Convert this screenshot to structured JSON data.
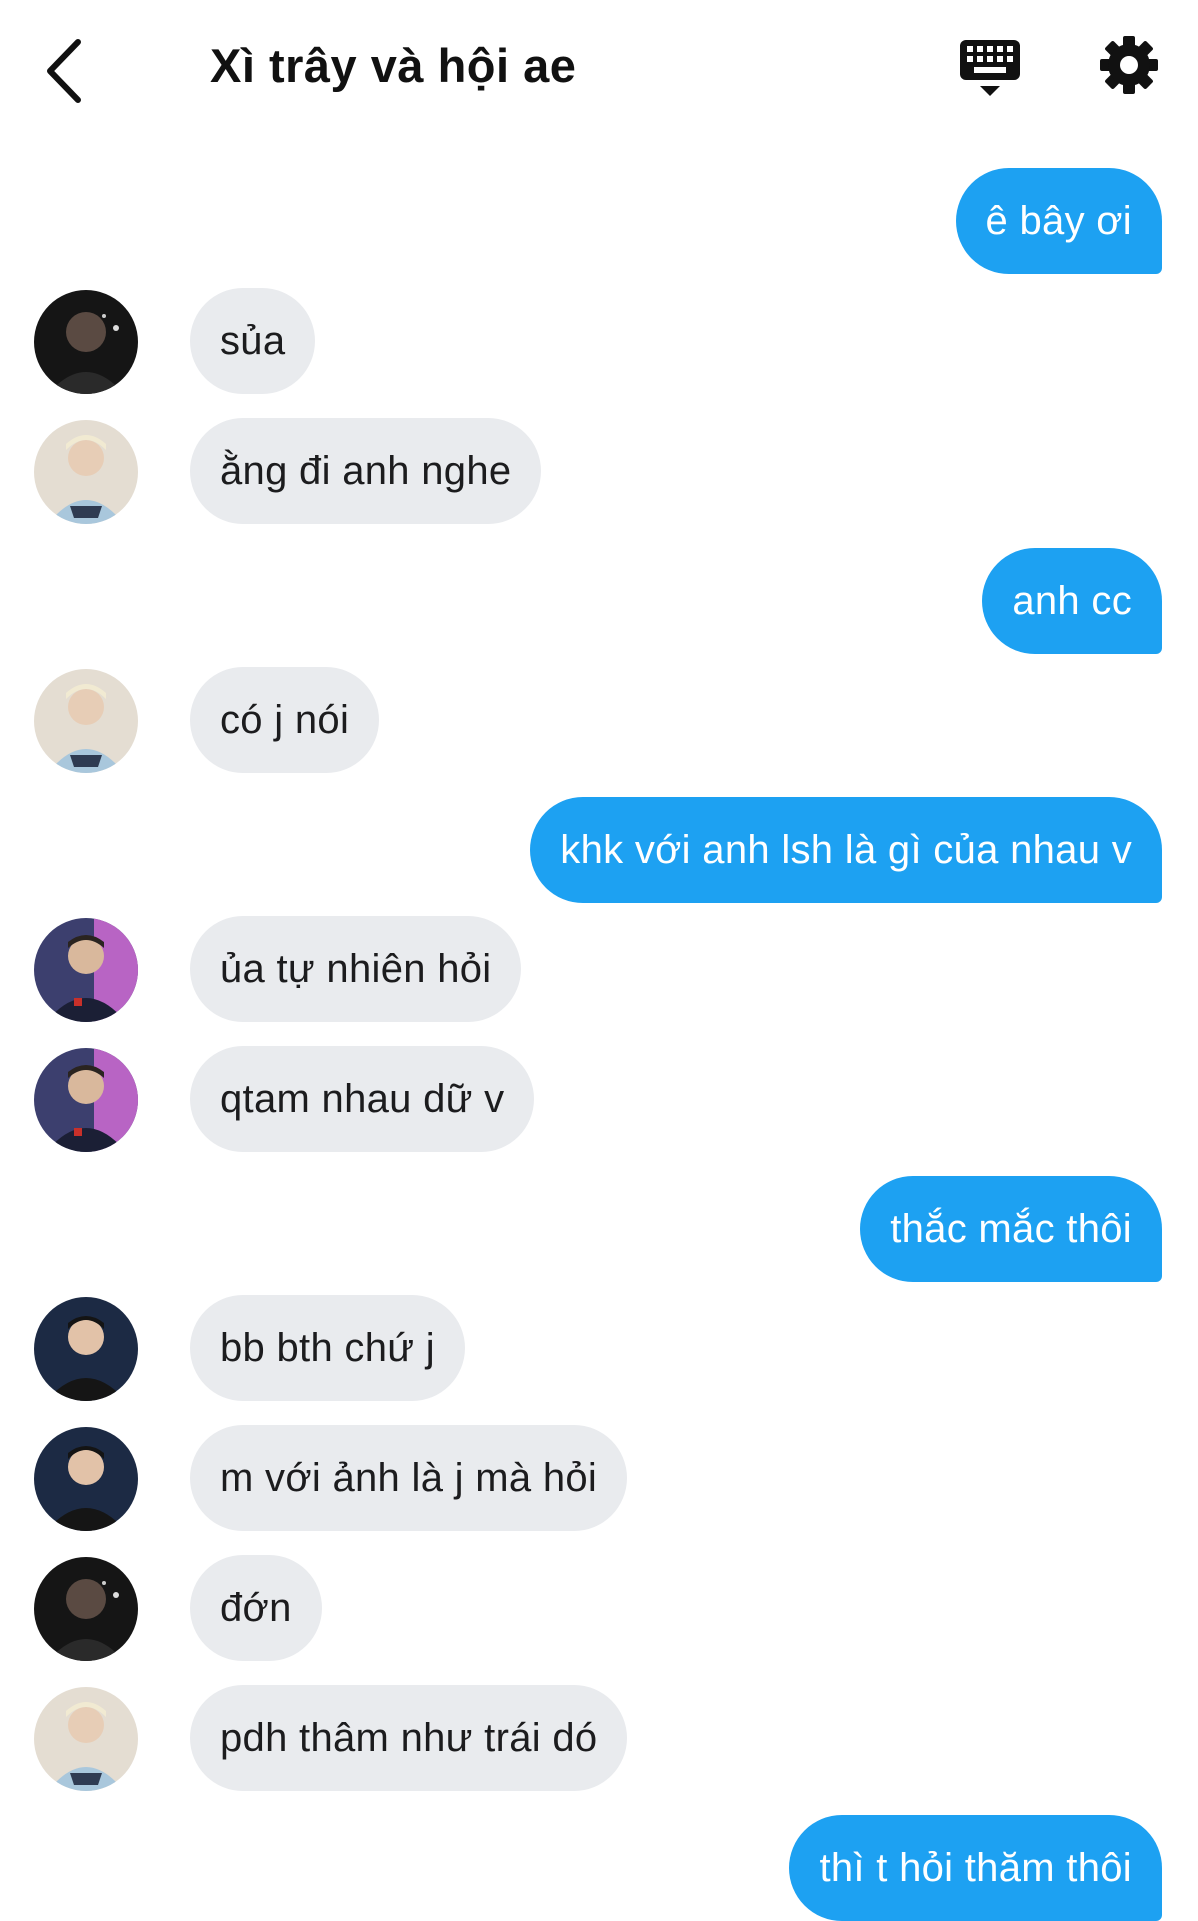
{
  "header": {
    "title": "Xì trây và hội ae",
    "back_icon": "chevron-left-icon",
    "keyboard_icon": "keyboard-icon",
    "settings_icon": "gear-icon"
  },
  "colors": {
    "outgoing_bubble": "#1da1f2",
    "incoming_bubble": "#e9ebee",
    "background": "#ffffff"
  },
  "messages": [
    {
      "dir": "out",
      "text": "ê bây ơi"
    },
    {
      "dir": "in",
      "avatar": "avatar-a",
      "text": "sủa"
    },
    {
      "dir": "in",
      "avatar": "avatar-b",
      "text": "ằng đi anh nghe"
    },
    {
      "dir": "out",
      "text": "anh cc"
    },
    {
      "dir": "in",
      "avatar": "avatar-b",
      "text": "có j nói"
    },
    {
      "dir": "out",
      "text": "khk với anh lsh là gì của nhau v"
    },
    {
      "dir": "in",
      "avatar": "avatar-c",
      "text": "ủa tự nhiên hỏi"
    },
    {
      "dir": "in",
      "avatar": "avatar-c",
      "text": "qtam nhau dữ v"
    },
    {
      "dir": "out",
      "text": "thắc mắc thôi"
    },
    {
      "dir": "in",
      "avatar": "avatar-d",
      "text": "bb bth chứ j"
    },
    {
      "dir": "in",
      "avatar": "avatar-d",
      "text": "m với ảnh là j mà hỏi"
    },
    {
      "dir": "in",
      "avatar": "avatar-a",
      "text": "đớn"
    },
    {
      "dir": "in",
      "avatar": "avatar-b",
      "text": "pdh thâm như trái dó"
    },
    {
      "dir": "out",
      "text": "thì t hỏi thăm thôi"
    }
  ]
}
